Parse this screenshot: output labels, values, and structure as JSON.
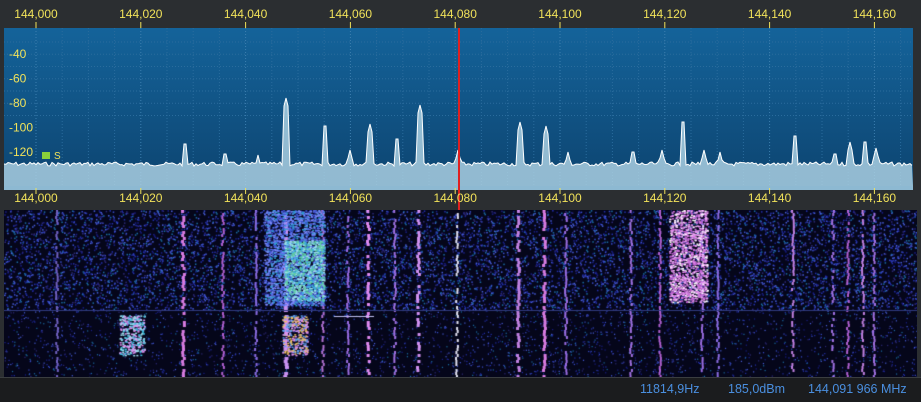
{
  "spectrum": {
    "freq_axis_top": [
      "144,000",
      "144,020",
      "144,040",
      "144,060",
      "144,080",
      "144,100",
      "144,120",
      "144,140",
      "144,160"
    ],
    "freq_axis_bottom": [
      "144,000",
      "144,020",
      "144,040",
      "144,060",
      "144,080",
      "144,100",
      "144,120",
      "144,140",
      "144,160"
    ],
    "db_labels": [
      "-40",
      "-60",
      "-80",
      "-100",
      "-120"
    ],
    "squelch_label": "S",
    "colors": {
      "background": "#0f4f7e",
      "trace": "#ffffff",
      "fill": "#9ec7dd",
      "axis_text": "#f1e25a",
      "tuning_line": "#e02020",
      "squelch_marker": "#8ad03a"
    }
  },
  "status": {
    "offset": "11814,9Hz",
    "level": "185,0dBm",
    "frequency": "144,091 966 MHz"
  }
}
